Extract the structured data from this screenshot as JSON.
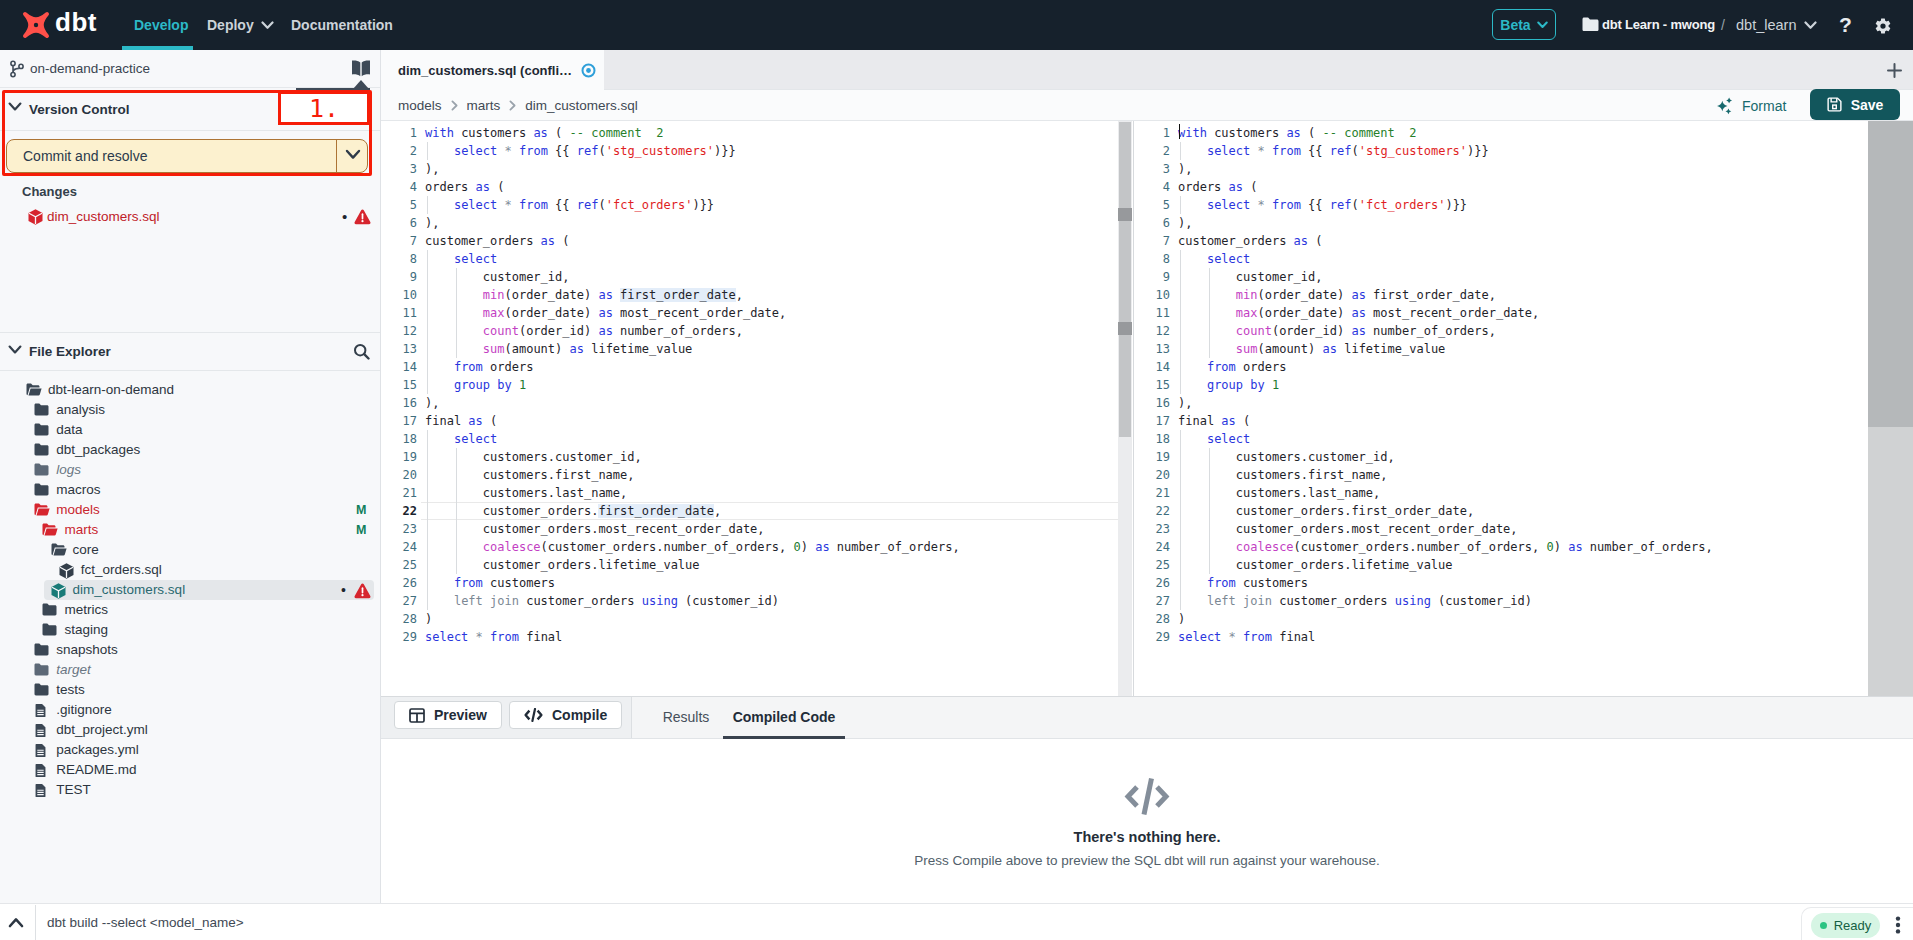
{
  "navbar": {
    "logo_text": "dbt",
    "develop": "Develop",
    "deploy": "Deploy",
    "documentation": "Documentation",
    "beta": "Beta",
    "project": "dbt Learn - mwong",
    "separator": "/",
    "environment": "dbt_learn",
    "help": "?"
  },
  "sidebar": {
    "branch": "on-demand-practice",
    "version_control": {
      "title": "Version Control",
      "commit_button": "Commit and resolve",
      "annotation_label": "1."
    },
    "changes": {
      "title": "Changes",
      "file": "dim_customers.sql",
      "dot": "•"
    },
    "file_explorer": {
      "title": "File Explorer",
      "tree": [
        {
          "name": "dbt-learn-on-demand",
          "icon": "folder-open",
          "level": 0
        },
        {
          "name": "analysis",
          "icon": "folder",
          "level": 1
        },
        {
          "name": "data",
          "icon": "folder",
          "level": 1
        },
        {
          "name": "dbt_packages",
          "icon": "folder",
          "level": 1
        },
        {
          "name": "logs",
          "icon": "folder-muted",
          "level": 1,
          "style": "muted"
        },
        {
          "name": "macros",
          "icon": "folder",
          "level": 1
        },
        {
          "name": "models",
          "icon": "folder-open-red",
          "level": 1,
          "style": "red",
          "badge": "M"
        },
        {
          "name": "marts",
          "icon": "folder-open-red",
          "level": 2,
          "style": "red",
          "badge": "M"
        },
        {
          "name": "core",
          "icon": "folder-open",
          "level": 3
        },
        {
          "name": "fct_orders.sql",
          "icon": "cube",
          "level": 4
        },
        {
          "name": "dim_customers.sql",
          "icon": "cube-teal",
          "level": 3,
          "style": "teal",
          "selected": true,
          "dot": "•",
          "warning": true
        },
        {
          "name": "metrics",
          "icon": "folder",
          "level": 2
        },
        {
          "name": "staging",
          "icon": "folder",
          "level": 2
        },
        {
          "name": "snapshots",
          "icon": "folder",
          "level": 1
        },
        {
          "name": "target",
          "icon": "folder-muted",
          "level": 1,
          "style": "muted"
        },
        {
          "name": "tests",
          "icon": "folder",
          "level": 1
        },
        {
          "name": ".gitignore",
          "icon": "doc",
          "level": 1
        },
        {
          "name": "dbt_project.yml",
          "icon": "doc",
          "level": 1
        },
        {
          "name": "packages.yml",
          "icon": "doc",
          "level": 1
        },
        {
          "name": "README.md",
          "icon": "doc",
          "level": 1
        },
        {
          "name": "TEST",
          "icon": "doc",
          "level": 1
        }
      ]
    }
  },
  "tabs": {
    "active": "dim_customers.sql (confli…"
  },
  "breadcrumb": [
    "models",
    "marts",
    "dim_customers.sql"
  ],
  "actions": {
    "format": "Format",
    "save": "Save"
  },
  "editor": {
    "lines": [
      {
        "n": 1,
        "tokens": [
          [
            "kw",
            "with"
          ],
          [
            "t",
            " customers "
          ],
          [
            "kw",
            "as"
          ],
          [
            "t",
            " ( "
          ],
          [
            "cmt",
            "-- comment  2"
          ]
        ]
      },
      {
        "n": 2,
        "tokens": [
          [
            "t",
            "    "
          ],
          [
            "kw",
            "select"
          ],
          [
            "t",
            " "
          ],
          [
            "op",
            "*"
          ],
          [
            "t",
            " "
          ],
          [
            "kw",
            "from"
          ],
          [
            "t",
            " {{ "
          ],
          [
            "kw",
            "ref"
          ],
          [
            "t",
            "("
          ],
          [
            "str",
            "'stg_customers'"
          ],
          [
            "t",
            ")}}"
          ]
        ]
      },
      {
        "n": 3,
        "tokens": [
          [
            "t",
            "),"
          ]
        ]
      },
      {
        "n": 4,
        "tokens": [
          [
            "t",
            "orders "
          ],
          [
            "kw",
            "as"
          ],
          [
            "t",
            " ("
          ]
        ]
      },
      {
        "n": 5,
        "tokens": [
          [
            "t",
            "    "
          ],
          [
            "kw",
            "select"
          ],
          [
            "t",
            " "
          ],
          [
            "op",
            "*"
          ],
          [
            "t",
            " "
          ],
          [
            "kw",
            "from"
          ],
          [
            "t",
            " {{ "
          ],
          [
            "kw",
            "ref"
          ],
          [
            "t",
            "("
          ],
          [
            "str",
            "'fct_orders'"
          ],
          [
            "t",
            ")}}"
          ]
        ]
      },
      {
        "n": 6,
        "tokens": [
          [
            "t",
            "),"
          ]
        ]
      },
      {
        "n": 7,
        "tokens": [
          [
            "t",
            "customer_orders "
          ],
          [
            "kw",
            "as"
          ],
          [
            "t",
            " ("
          ]
        ]
      },
      {
        "n": 8,
        "tokens": [
          [
            "t",
            "    "
          ],
          [
            "kw",
            "select"
          ]
        ]
      },
      {
        "n": 9,
        "tokens": [
          [
            "t",
            "        customer_id,"
          ]
        ]
      },
      {
        "n": 10,
        "tokens": [
          [
            "t",
            "        "
          ],
          [
            "fn",
            "min"
          ],
          [
            "t",
            "(order_date) "
          ],
          [
            "kw",
            "as"
          ],
          [
            "t",
            " "
          ],
          [
            "hl",
            "first_order_date"
          ],
          [
            "t",
            ","
          ]
        ]
      },
      {
        "n": 11,
        "tokens": [
          [
            "t",
            "        "
          ],
          [
            "fn",
            "max"
          ],
          [
            "t",
            "(order_date) "
          ],
          [
            "kw",
            "as"
          ],
          [
            "t",
            " most_recent_order_date,"
          ]
        ]
      },
      {
        "n": 12,
        "tokens": [
          [
            "t",
            "        "
          ],
          [
            "fn",
            "count"
          ],
          [
            "t",
            "(order_id) "
          ],
          [
            "kw",
            "as"
          ],
          [
            "t",
            " number_of_orders,"
          ]
        ]
      },
      {
        "n": 13,
        "tokens": [
          [
            "t",
            "        "
          ],
          [
            "fn",
            "sum"
          ],
          [
            "t",
            "(amount) "
          ],
          [
            "kw",
            "as"
          ],
          [
            "t",
            " lifetime_value"
          ]
        ]
      },
      {
        "n": 14,
        "tokens": [
          [
            "t",
            "    "
          ],
          [
            "kw",
            "from"
          ],
          [
            "t",
            " orders"
          ]
        ]
      },
      {
        "n": 15,
        "tokens": [
          [
            "t",
            "    "
          ],
          [
            "kw",
            "group"
          ],
          [
            "t",
            " "
          ],
          [
            "kw",
            "by"
          ],
          [
            "t",
            " "
          ],
          [
            "num",
            "1"
          ]
        ]
      },
      {
        "n": 16,
        "tokens": [
          [
            "t",
            "),"
          ]
        ]
      },
      {
        "n": 17,
        "tokens": [
          [
            "t",
            "final "
          ],
          [
            "kw",
            "as"
          ],
          [
            "t",
            " ("
          ]
        ]
      },
      {
        "n": 18,
        "tokens": [
          [
            "t",
            "    "
          ],
          [
            "kw",
            "select"
          ]
        ]
      },
      {
        "n": 19,
        "tokens": [
          [
            "t",
            "        customers.customer_id,"
          ]
        ]
      },
      {
        "n": 20,
        "tokens": [
          [
            "t",
            "        customers.first_name,"
          ]
        ]
      },
      {
        "n": 21,
        "tokens": [
          [
            "t",
            "        customers.last_name,"
          ]
        ]
      },
      {
        "n": 22,
        "active": true,
        "tokens": [
          [
            "t",
            "        customer_orders."
          ],
          [
            "hl",
            "first_order_date"
          ],
          [
            "t",
            ","
          ]
        ]
      },
      {
        "n": 23,
        "tokens": [
          [
            "t",
            "        customer_orders.most_recent_order_date,"
          ]
        ]
      },
      {
        "n": 24,
        "tokens": [
          [
            "t",
            "        "
          ],
          [
            "fn",
            "coalesce"
          ],
          [
            "t",
            "(customer_orders.number_of_orders, "
          ],
          [
            "num",
            "0"
          ],
          [
            "t",
            ") "
          ],
          [
            "kw",
            "as"
          ],
          [
            "t",
            " number_of_orders,"
          ]
        ]
      },
      {
        "n": 25,
        "tokens": [
          [
            "t",
            "        customer_orders.lifetime_value"
          ]
        ]
      },
      {
        "n": 26,
        "tokens": [
          [
            "t",
            "    "
          ],
          [
            "kw",
            "from"
          ],
          [
            "t",
            " customers"
          ]
        ]
      },
      {
        "n": 27,
        "tokens": [
          [
            "t",
            "    "
          ],
          [
            "gr",
            "left join"
          ],
          [
            "t",
            " customer_orders "
          ],
          [
            "kw",
            "using"
          ],
          [
            "t",
            " (customer_id)"
          ]
        ]
      },
      {
        "n": 28,
        "tokens": [
          [
            "t",
            ")"
          ]
        ]
      },
      {
        "n": 29,
        "tokens": [
          [
            "kw",
            "select"
          ],
          [
            "t",
            " "
          ],
          [
            "op",
            "*"
          ],
          [
            "t",
            " "
          ],
          [
            "kw",
            "from"
          ],
          [
            "t",
            " final"
          ]
        ]
      }
    ]
  },
  "results": {
    "preview": "Preview",
    "compile": "Compile",
    "tab_results": "Results",
    "tab_compiled": "Compiled Code",
    "empty_title": "There's nothing here.",
    "empty_subtitle": "Press Compile above to preview the SQL dbt will run against your warehouse."
  },
  "statusbar": {
    "command": "dbt build --select <model_name>",
    "status": "Ready"
  }
}
